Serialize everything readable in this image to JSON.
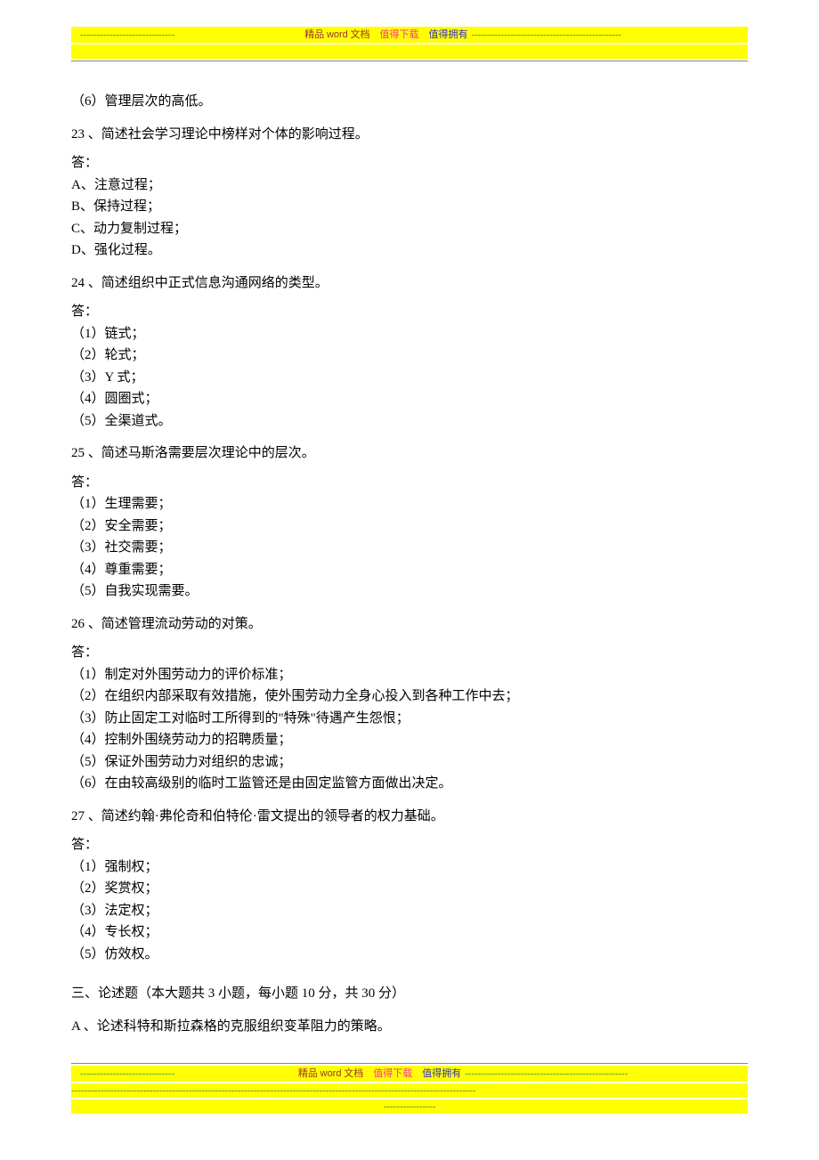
{
  "header": {
    "dashes_left": "-----------------------------",
    "text_brown_pre": "精品 ",
    "text_word": "word",
    "text_brown_post": " 文档",
    "text_pink": "值得下载",
    "text_blue": "值得拥有",
    "dashes_right": "----------------------------------------------"
  },
  "content": {
    "line6": "（6）管理层次的高低。",
    "q23": {
      "title": "23 、简述社会学习理论中榜样对个体的影响过程。",
      "ans_label": "答：",
      "items": [
        "A、注意过程；",
        "B、保持过程；",
        "C、动力复制过程；",
        "D、强化过程。"
      ]
    },
    "q24": {
      "title": "24 、简述组织中正式信息沟通网络的类型。",
      "ans_label": "答：",
      "items": [
        "（1）链式；",
        "（2）轮式；",
        "（3）Y 式；",
        "（4）圆圈式；",
        "（5）全渠道式。"
      ]
    },
    "q25": {
      "title": "25 、简述马斯洛需要层次理论中的层次。",
      "ans_label": "答：",
      "items": [
        "（1）生理需要；",
        "（2）安全需要；",
        "（3）社交需要；",
        "（4）尊重需要；",
        "（5）自我实现需要。"
      ]
    },
    "q26": {
      "title": "26 、简述管理流动劳动的对策。",
      "ans_label": "答：",
      "items": [
        "（1）制定对外围劳动力的评价标准；",
        "（2）在组织内部采取有效措施，使外围劳动力全身心投入到各种工作中去；",
        "（3）防止固定工对临时工所得到的\"特殊\"待遇产生怨恨；",
        "（4）控制外围绕劳动力的招聘质量；",
        "（5）保证外围劳动力对组织的忠诚；",
        "（6）在由较高级别的临时工监管还是由固定监管方面做出决定。"
      ]
    },
    "q27": {
      "title": "27 、简述约翰·弗伦奇和伯特伦·雷文提出的领导者的权力基础。",
      "ans_label": "答：",
      "items": [
        "（1）强制权；",
        "（2）奖赏权；",
        "（3）法定权；",
        "（4）专长权；",
        "（5）仿效权。"
      ]
    },
    "sec3": "三、论述题（本大题共   3 小题，每小题  10 分，共 30 分）",
    "qA": "A 、论述科特和斯拉森格的克服组织变革阻力的策略。"
  },
  "footer": {
    "dashes_left": "-----------------------------",
    "text_brown_pre": "精品 ",
    "text_word": "word",
    "text_brown_post": " 文档",
    "text_pink": "值得下载",
    "text_blue": "值得拥有",
    "dashes_right": "--------------------------------------------------",
    "row2_dashes": "----------------------------------------------------------------------------------------------------------------------------",
    "row3_dashes": "----------------"
  }
}
